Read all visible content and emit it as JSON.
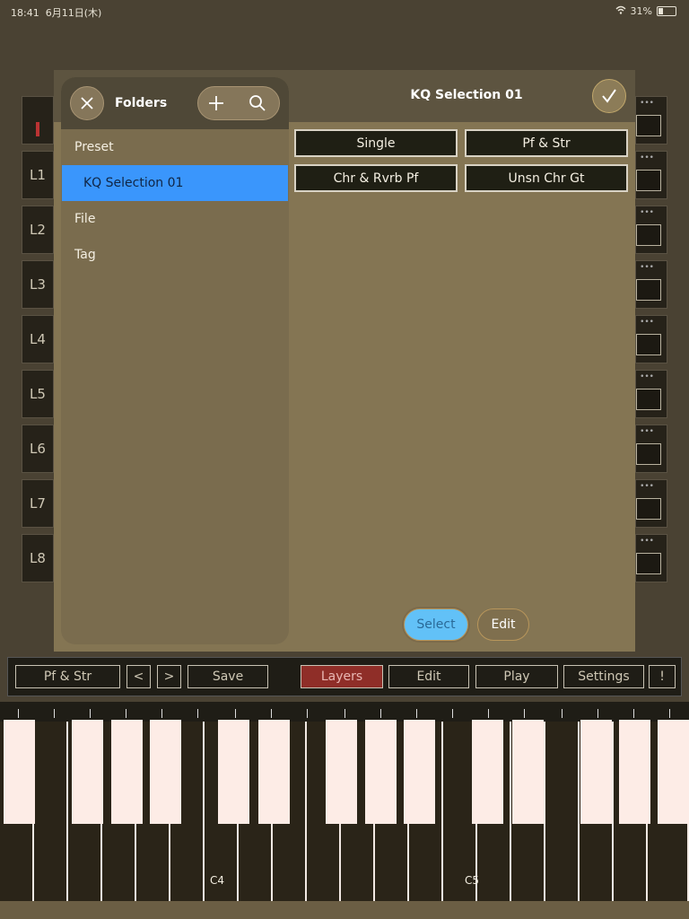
{
  "status": {
    "time": "18:41",
    "date": "6月11日(木)",
    "battery": "31%"
  },
  "layers": [
    "L1",
    "L2",
    "L3",
    "L4",
    "L5",
    "L6",
    "L7",
    "L8"
  ],
  "modal": {
    "title": "KQ Selection 01",
    "folders_title": "Folders",
    "folders": [
      "Preset",
      "KQ Selection 01",
      "File",
      "Tag"
    ],
    "selected_folder": "KQ Selection 01",
    "presets": [
      "Single",
      "Pf & Str",
      "Chr & Rvrb Pf",
      "Unsn Chr Gt"
    ],
    "select_label": "Select",
    "edit_label": "Edit"
  },
  "toolbar": {
    "current_preset": "Pf & Str",
    "prev": "<",
    "next": ">",
    "save": "Save",
    "layers": "Layers",
    "edit": "Edit",
    "play": "Play",
    "settings": "Settings",
    "info": "!"
  },
  "keyboard": {
    "label_c4": "C4",
    "label_c5": "C5"
  },
  "colors": {
    "accent": "#3a96fc",
    "active_tab": "#8f2e28",
    "modal_bg": "#847553"
  }
}
